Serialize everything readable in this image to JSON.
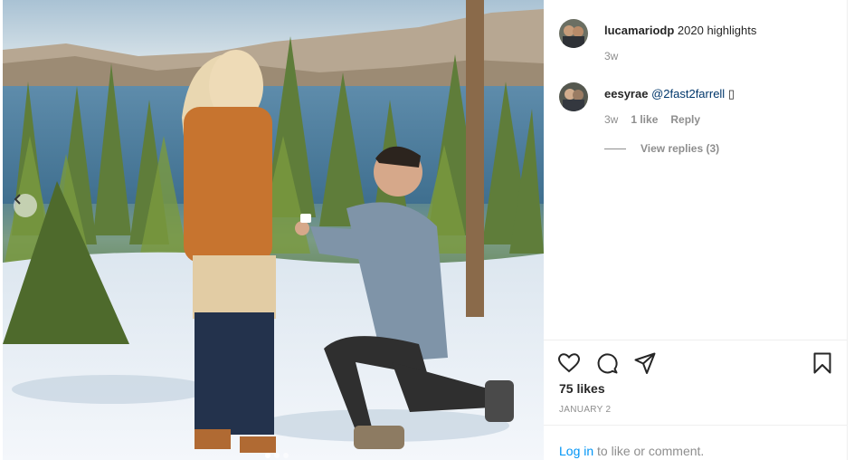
{
  "post": {
    "photo_description": "",
    "caption": {
      "username": "lucamariodp",
      "text": "2020 highlights",
      "time": "3w"
    },
    "comments": [
      {
        "username": "eesyrae",
        "mention": "@2fast2farrell",
        "emoji": "▯",
        "time": "3w",
        "likes": "1 like",
        "reply_label": "Reply"
      }
    ],
    "view_replies": "View replies (3)",
    "likes": "75 likes",
    "date": "JANUARY 2",
    "login": {
      "link": "Log in",
      "text": " to like or comment."
    },
    "icons": [
      "heart-icon",
      "comment-icon",
      "share-icon",
      "bookmark-icon",
      "chevron-left-icon"
    ],
    "colors": {
      "link": "#0095f6",
      "mention": "#00376b",
      "muted": "#8e8e8e"
    }
  }
}
